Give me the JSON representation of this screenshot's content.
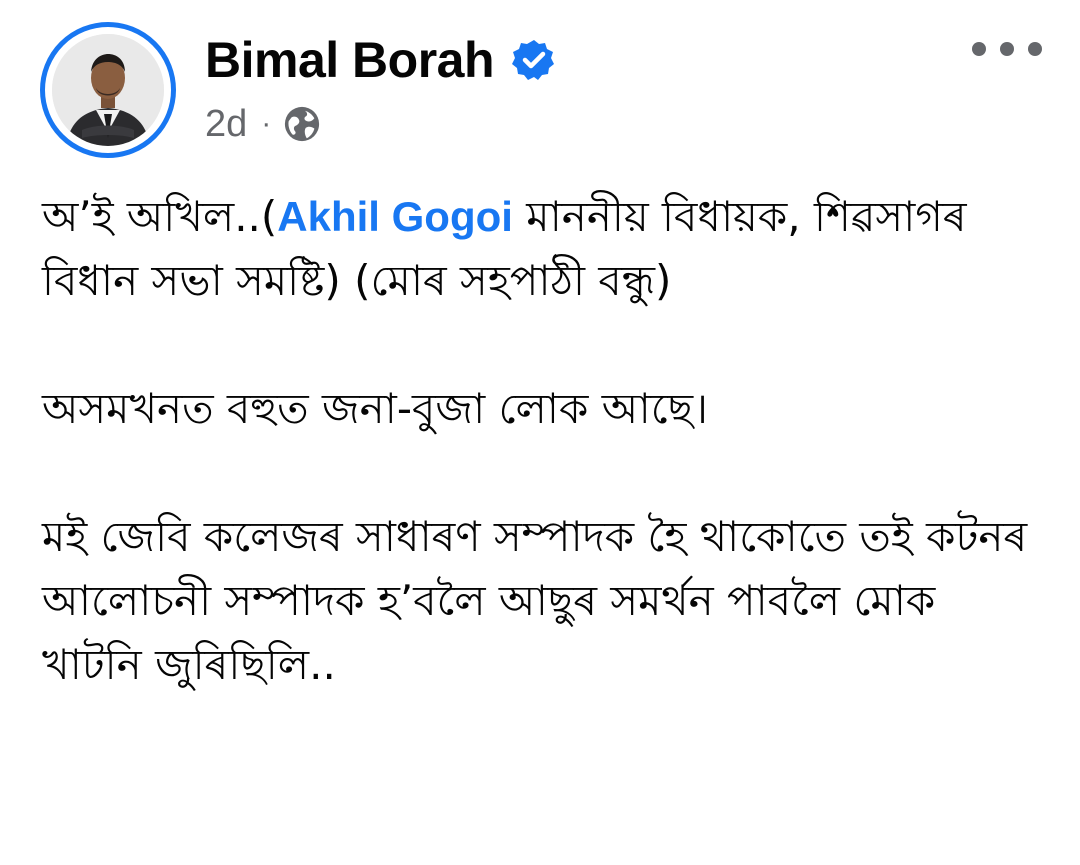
{
  "post": {
    "author": {
      "name": "Bimal Borah",
      "verified": true,
      "avatar": "profile-photo-man-in-suit"
    },
    "timestamp": "2d",
    "separator": "·",
    "privacy_icon": "globe-icon",
    "more_icon": "more-horizontal-icon",
    "colors": {
      "accent": "#1877f2",
      "text": "#050505",
      "muted": "#65676b"
    },
    "paragraphs": [
      {
        "before": "অ’ই অখিল..(",
        "mention": "Akhil Gogoi",
        "after": " মাননীয় বিধায়ক, শিৱসাগৰ বিধান সভা সমষ্টি) (মোৰ সহপাঠী বন্ধু)"
      },
      {
        "text": "অসমখনত বহুত জনা-বুজা লোক আছে।"
      },
      {
        "text": "মই জেবি কলেজৰ সাধাৰণ সম্পাদক হৈ থাকোতে তই কটনৰ আলোচনী সম্পাদক হ’বলৈ আছুৰ সমৰ্থন পাবলৈ মোক খাটনি জুৰিছিলি.."
      }
    ]
  }
}
